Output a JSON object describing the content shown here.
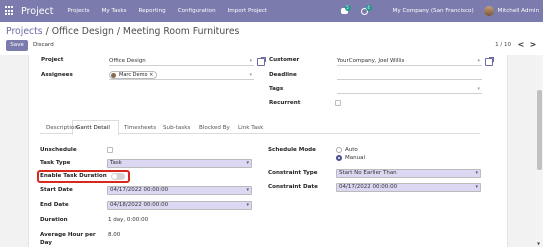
{
  "navbar": {
    "app_name": "Project",
    "menu": [
      "Projects",
      "My Tasks",
      "Reporting",
      "Configuration",
      "Import Project"
    ],
    "chat_badge": "5",
    "activity_badge": "4",
    "company": "My Company (San Francisco)",
    "user": "Mitchell Admin"
  },
  "breadcrumb": {
    "parent": "Projects",
    "separator": " / ",
    "current": "Office Design / Meeting Room Furnitures"
  },
  "actions": {
    "save": "Save",
    "discard": "Discard"
  },
  "pager": {
    "value": "1 / 10",
    "prev": "<",
    "next": ">"
  },
  "form": {
    "project_label": "Project",
    "project_value": "Office Design",
    "assignees_label": "Assignees",
    "assignee_tag": "Marc Demo",
    "customer_label": "Customer",
    "customer_value": "YourCompany, Joel Willis",
    "deadline_label": "Deadline",
    "tags_label": "Tags",
    "recurrent_label": "Recurrent"
  },
  "tabs": [
    "Description",
    "Gantt Detail",
    "Timesheets",
    "Sub-tasks",
    "Blocked By",
    "Link Task"
  ],
  "gantt": {
    "unschedule_label": "Unschedule",
    "task_type_label": "Task Type",
    "task_type_value": "Task",
    "enable_duration_label": "Enable Task Duration",
    "start_date_label": "Start Date",
    "start_date_value": "04/17/2022 00:00:00",
    "end_date_label": "End Date",
    "end_date_value": "04/18/2022 00:00:00",
    "duration_label": "Duration",
    "duration_value": "1 day, 0:00:00",
    "avg_hour_label_1": "Average Hour per",
    "avg_hour_label_2": "Day",
    "avg_hour_value": "8.00",
    "schedule_mode_label": "Schedule Mode",
    "schedule_mode_options": [
      "Auto",
      "Manual"
    ],
    "schedule_mode_selected": "Manual",
    "constraint_type_label": "Constraint Type",
    "constraint_type_value": "Start No Earlier Than",
    "constraint_date_label": "Constraint Date",
    "constraint_date_value": "04/17/2022 00:00:00"
  },
  "colors": {
    "brand": "#7c7bad",
    "highlight": "#d9281f",
    "select_bg": "#dcd7f3"
  }
}
